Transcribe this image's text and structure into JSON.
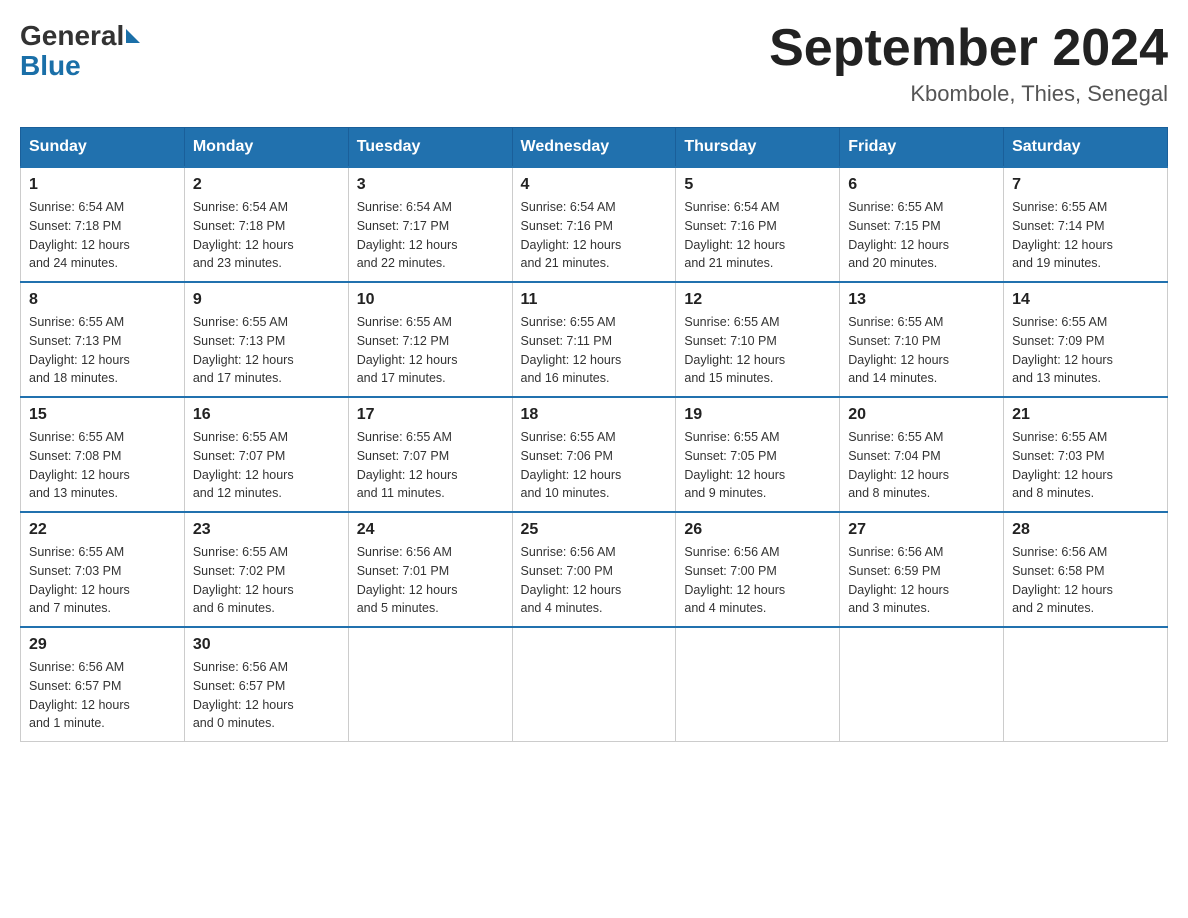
{
  "header": {
    "logo_general": "General",
    "logo_blue": "Blue",
    "month_title": "September 2024",
    "location": "Kbombole, Thies, Senegal"
  },
  "days_of_week": [
    "Sunday",
    "Monday",
    "Tuesday",
    "Wednesday",
    "Thursday",
    "Friday",
    "Saturday"
  ],
  "weeks": [
    [
      {
        "day": "1",
        "sunrise": "6:54 AM",
        "sunset": "7:18 PM",
        "daylight": "12 hours and 24 minutes."
      },
      {
        "day": "2",
        "sunrise": "6:54 AM",
        "sunset": "7:18 PM",
        "daylight": "12 hours and 23 minutes."
      },
      {
        "day": "3",
        "sunrise": "6:54 AM",
        "sunset": "7:17 PM",
        "daylight": "12 hours and 22 minutes."
      },
      {
        "day": "4",
        "sunrise": "6:54 AM",
        "sunset": "7:16 PM",
        "daylight": "12 hours and 21 minutes."
      },
      {
        "day": "5",
        "sunrise": "6:54 AM",
        "sunset": "7:16 PM",
        "daylight": "12 hours and 21 minutes."
      },
      {
        "day": "6",
        "sunrise": "6:55 AM",
        "sunset": "7:15 PM",
        "daylight": "12 hours and 20 minutes."
      },
      {
        "day": "7",
        "sunrise": "6:55 AM",
        "sunset": "7:14 PM",
        "daylight": "12 hours and 19 minutes."
      }
    ],
    [
      {
        "day": "8",
        "sunrise": "6:55 AM",
        "sunset": "7:13 PM",
        "daylight": "12 hours and 18 minutes."
      },
      {
        "day": "9",
        "sunrise": "6:55 AM",
        "sunset": "7:13 PM",
        "daylight": "12 hours and 17 minutes."
      },
      {
        "day": "10",
        "sunrise": "6:55 AM",
        "sunset": "7:12 PM",
        "daylight": "12 hours and 17 minutes."
      },
      {
        "day": "11",
        "sunrise": "6:55 AM",
        "sunset": "7:11 PM",
        "daylight": "12 hours and 16 minutes."
      },
      {
        "day": "12",
        "sunrise": "6:55 AM",
        "sunset": "7:10 PM",
        "daylight": "12 hours and 15 minutes."
      },
      {
        "day": "13",
        "sunrise": "6:55 AM",
        "sunset": "7:10 PM",
        "daylight": "12 hours and 14 minutes."
      },
      {
        "day": "14",
        "sunrise": "6:55 AM",
        "sunset": "7:09 PM",
        "daylight": "12 hours and 13 minutes."
      }
    ],
    [
      {
        "day": "15",
        "sunrise": "6:55 AM",
        "sunset": "7:08 PM",
        "daylight": "12 hours and 13 minutes."
      },
      {
        "day": "16",
        "sunrise": "6:55 AM",
        "sunset": "7:07 PM",
        "daylight": "12 hours and 12 minutes."
      },
      {
        "day": "17",
        "sunrise": "6:55 AM",
        "sunset": "7:07 PM",
        "daylight": "12 hours and 11 minutes."
      },
      {
        "day": "18",
        "sunrise": "6:55 AM",
        "sunset": "7:06 PM",
        "daylight": "12 hours and 10 minutes."
      },
      {
        "day": "19",
        "sunrise": "6:55 AM",
        "sunset": "7:05 PM",
        "daylight": "12 hours and 9 minutes."
      },
      {
        "day": "20",
        "sunrise": "6:55 AM",
        "sunset": "7:04 PM",
        "daylight": "12 hours and 8 minutes."
      },
      {
        "day": "21",
        "sunrise": "6:55 AM",
        "sunset": "7:03 PM",
        "daylight": "12 hours and 8 minutes."
      }
    ],
    [
      {
        "day": "22",
        "sunrise": "6:55 AM",
        "sunset": "7:03 PM",
        "daylight": "12 hours and 7 minutes."
      },
      {
        "day": "23",
        "sunrise": "6:55 AM",
        "sunset": "7:02 PM",
        "daylight": "12 hours and 6 minutes."
      },
      {
        "day": "24",
        "sunrise": "6:56 AM",
        "sunset": "7:01 PM",
        "daylight": "12 hours and 5 minutes."
      },
      {
        "day": "25",
        "sunrise": "6:56 AM",
        "sunset": "7:00 PM",
        "daylight": "12 hours and 4 minutes."
      },
      {
        "day": "26",
        "sunrise": "6:56 AM",
        "sunset": "7:00 PM",
        "daylight": "12 hours and 4 minutes."
      },
      {
        "day": "27",
        "sunrise": "6:56 AM",
        "sunset": "6:59 PM",
        "daylight": "12 hours and 3 minutes."
      },
      {
        "day": "28",
        "sunrise": "6:56 AM",
        "sunset": "6:58 PM",
        "daylight": "12 hours and 2 minutes."
      }
    ],
    [
      {
        "day": "29",
        "sunrise": "6:56 AM",
        "sunset": "6:57 PM",
        "daylight": "12 hours and 1 minute."
      },
      {
        "day": "30",
        "sunrise": "6:56 AM",
        "sunset": "6:57 PM",
        "daylight": "12 hours and 0 minutes."
      },
      null,
      null,
      null,
      null,
      null
    ]
  ],
  "labels": {
    "sunrise": "Sunrise:",
    "sunset": "Sunset:",
    "daylight": "Daylight:"
  }
}
